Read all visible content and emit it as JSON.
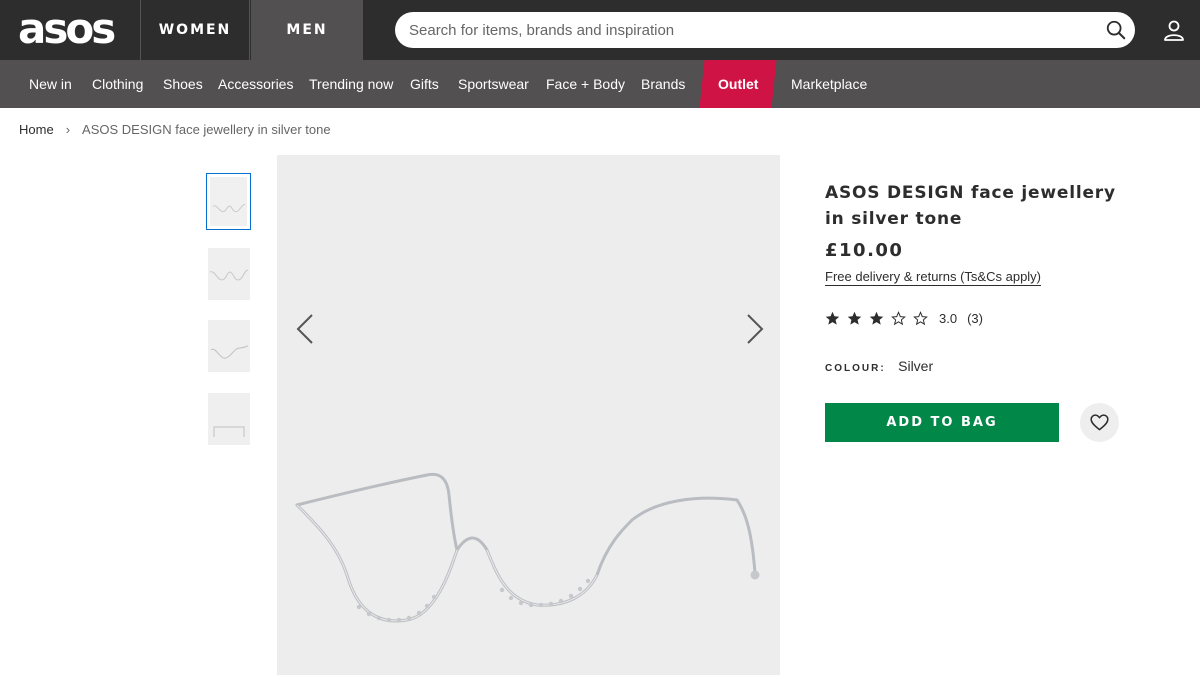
{
  "header": {
    "logo": "asos",
    "gender_tabs": {
      "women": "WOMEN",
      "men": "MEN"
    },
    "search_placeholder": "Search for items, brands and inspiration"
  },
  "nav": {
    "items": [
      {
        "label": "New in"
      },
      {
        "label": "Clothing"
      },
      {
        "label": "Shoes"
      },
      {
        "label": "Accessories"
      },
      {
        "label": "Trending now"
      },
      {
        "label": "Gifts"
      },
      {
        "label": "Sportswear"
      },
      {
        "label": "Face + Body"
      },
      {
        "label": "Brands"
      },
      {
        "label": "Outlet"
      },
      {
        "label": "Marketplace"
      }
    ]
  },
  "breadcrumb": {
    "home": "Home",
    "separator": "›",
    "current": "ASOS DESIGN face jewellery in silver tone"
  },
  "product": {
    "title": "ASOS DESIGN face jewellery in silver tone",
    "price": "£10.00",
    "delivery_link": "Free delivery & returns (Ts&Cs apply)",
    "rating_value": "3.0",
    "rating_count": "(3)",
    "stars_filled": 3,
    "stars_total": 5,
    "colour_label": "COLOUR:",
    "colour_value": "Silver",
    "add_to_bag": "ADD TO BAG"
  },
  "colors": {
    "header_bg": "#2d2d2d",
    "nav_bg": "#525050",
    "outlet_bg": "#d01345",
    "add_to_bag_bg": "#018849",
    "thumb_active_border": "#0770cf"
  },
  "icons": {
    "search": "search-icon",
    "account": "account-icon",
    "prev": "chevron-left-icon",
    "next": "chevron-right-icon",
    "save": "heart-icon",
    "star": "star-icon"
  }
}
